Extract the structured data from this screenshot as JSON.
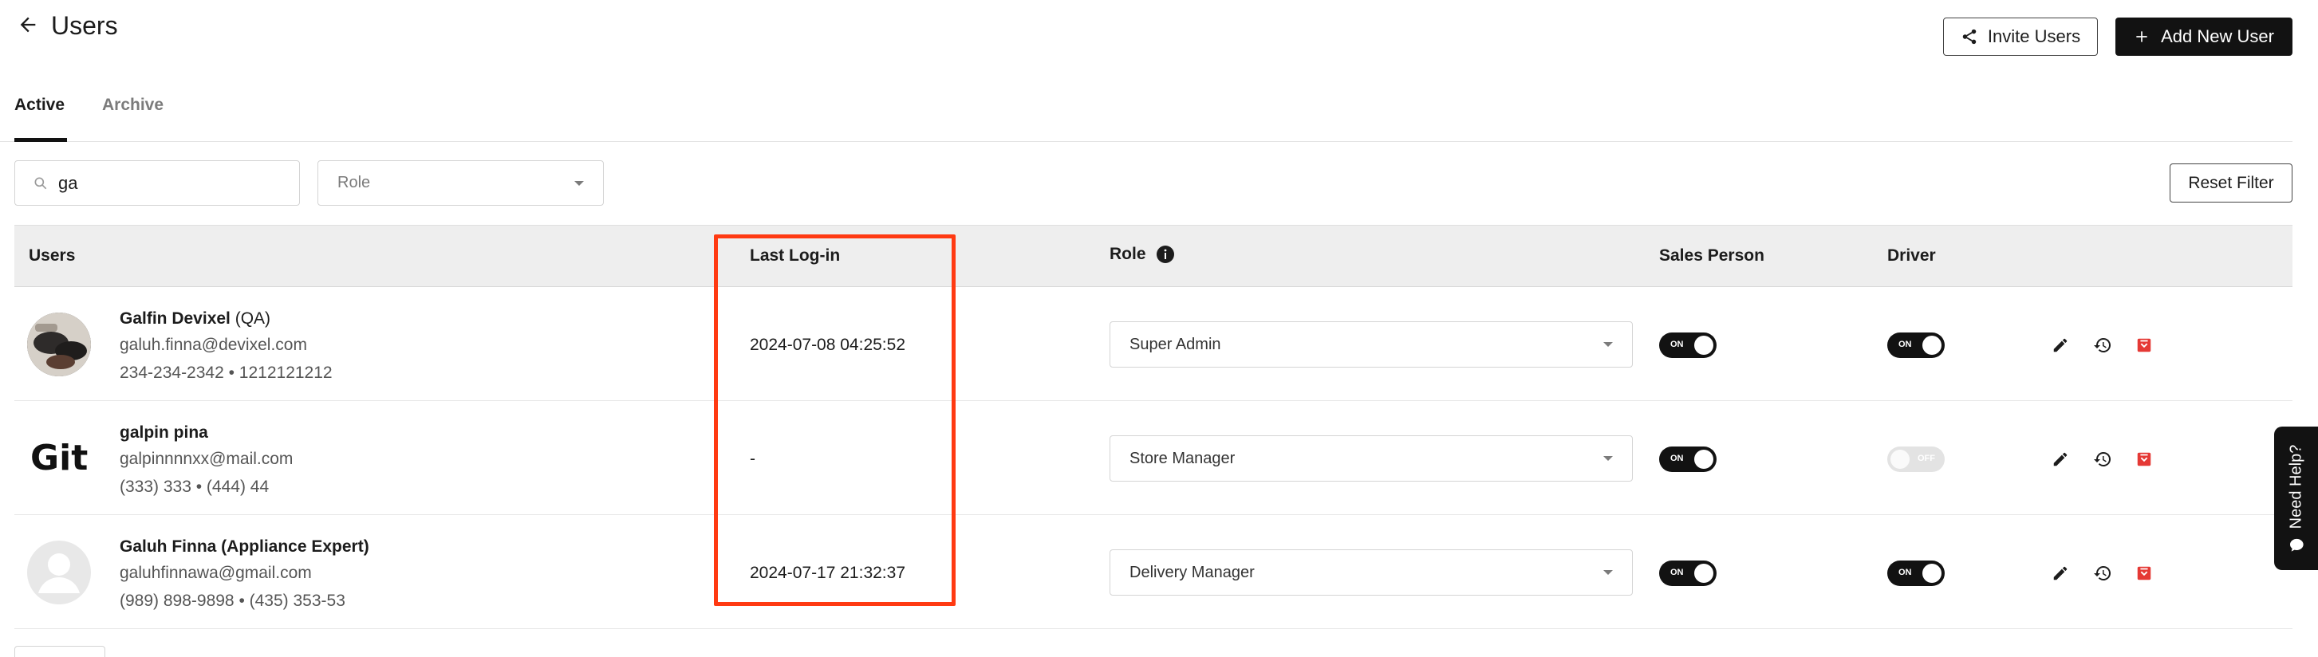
{
  "header": {
    "title": "Users",
    "invite_label": "Invite Users",
    "add_label": "Add New User"
  },
  "tabs": [
    {
      "label": "Active"
    },
    {
      "label": "Archive"
    }
  ],
  "filters": {
    "search_value": "ga",
    "role_placeholder": "Role",
    "reset_label": "Reset Filter"
  },
  "table": {
    "headers": {
      "users": "Users",
      "last_login": "Last Log-in",
      "role": "Role",
      "sales_person": "Sales Person",
      "driver": "Driver"
    },
    "rows": [
      {
        "name": "Galfin Devixel",
        "name_suffix": " (QA)",
        "email": "galuh.finna@devixel.com",
        "phones": "234-234-2342 • 1212121212",
        "last_login": "2024-07-08 04:25:52",
        "role": "Super Admin",
        "sales_person": "ON",
        "driver": "ON",
        "avatar": "photo"
      },
      {
        "name": "galpin pina",
        "name_suffix": "",
        "email": "galpinnnnxx@mail.com",
        "phones": "(333) 333 • (444) 44",
        "last_login": "-",
        "role": "Store Manager",
        "sales_person": "ON",
        "driver": "OFF",
        "avatar": "Git"
      },
      {
        "name": "Galuh Finna (Appliance Expert)",
        "name_suffix": "",
        "email": "galuhfinnawa@gmail.com",
        "phones": "(989) 898-9898 • (435) 353-53",
        "last_login": "2024-07-17 21:32:37",
        "role": "Delivery Manager",
        "sales_person": "ON",
        "driver": "ON",
        "avatar": "placeholder"
      }
    ]
  },
  "help": {
    "label": "Need Help?"
  },
  "colors": {
    "primary": "#121212",
    "highlight": "#ff3a12",
    "archive_icon": "#e53935"
  }
}
